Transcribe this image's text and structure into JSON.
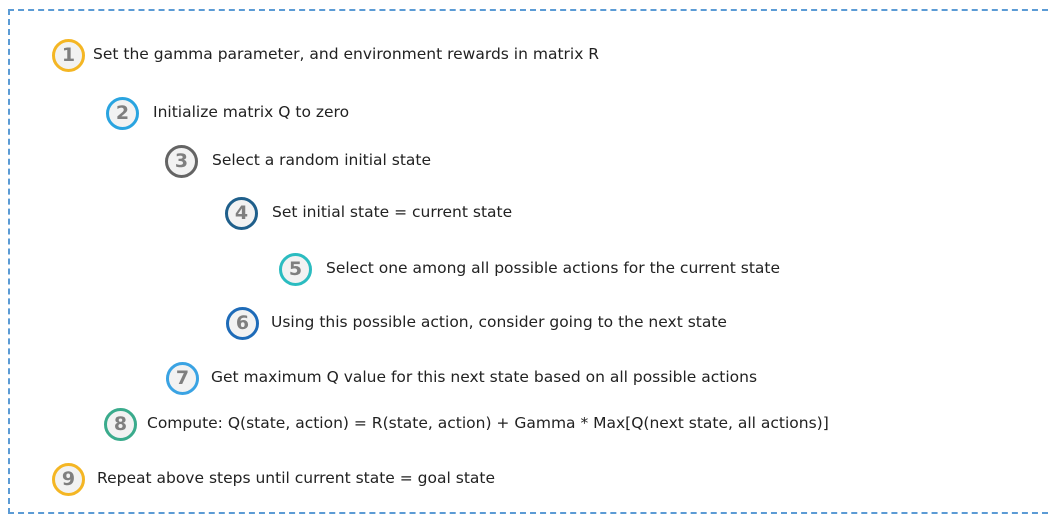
{
  "steps": [
    {
      "num": "1",
      "text": "Set the gamma parameter, and environment rewards in matrix R",
      "color": "#f4b624"
    },
    {
      "num": "2",
      "text": "Initialize matrix Q to zero",
      "color": "#2aa4e0"
    },
    {
      "num": "3",
      "text": "Select a random initial state",
      "color": "#646464"
    },
    {
      "num": "4",
      "text": "Set initial state = current state",
      "color": "#1f5f8b"
    },
    {
      "num": "5",
      "text": "Select one among all possible actions for the current state",
      "color": "#2bbcc0"
    },
    {
      "num": "6",
      "text": "Using this possible action, consider going to the next state",
      "color": "#1e6bb8"
    },
    {
      "num": "7",
      "text": "Get maximum Q value for this next state based on all possible actions",
      "color": "#3aa3e3"
    },
    {
      "num": "8",
      "text": "Compute: Q(state, action) = R(state, action) + Gamma * Max[Q(next state, all actions)]",
      "color": "#3aab8c"
    },
    {
      "num": "9",
      "text": "Repeat above steps until current state = goal state",
      "color": "#f4b624"
    }
  ],
  "border_color": "#5b9bd5"
}
